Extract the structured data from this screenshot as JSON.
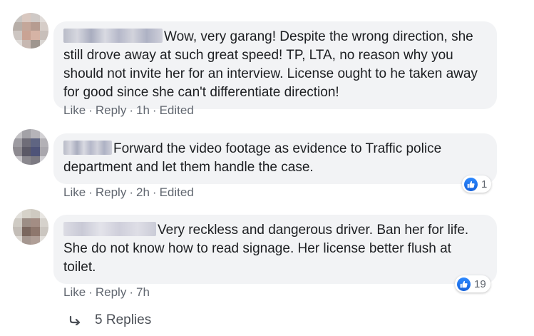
{
  "comments": [
    {
      "text": "Wow, very garang! Despite the wrong direction, she still drove away at such great speed! TP, LTA, no reason why you should not invite her for an interview. License ought to he taken away for good since she can't differentiate direction!",
      "like_label": "Like",
      "reply_label": "Reply",
      "time": "1h",
      "edited_label": "Edited"
    },
    {
      "text": "Forward the video footage as evidence to Traffic police department and let them handle the case.",
      "like_label": "Like",
      "reply_label": "Reply",
      "time": "2h",
      "edited_label": "Edited",
      "reaction_count": "1"
    },
    {
      "text": "Very reckless and dangerous driver. Ban her for life. She do not know how to read signage. Her license better flush at toilet.",
      "like_label": "Like",
      "reply_label": "Reply",
      "time": "7h",
      "reaction_count": "19"
    }
  ],
  "replies_label": "5 Replies",
  "icons": {
    "reaction": "thumbs-up-icon",
    "reply_arrow": "reply-arrow-icon"
  },
  "colors": {
    "bubble": "#f2f3f5",
    "meta_text": "#616770",
    "like_blue": "#1877f2"
  }
}
